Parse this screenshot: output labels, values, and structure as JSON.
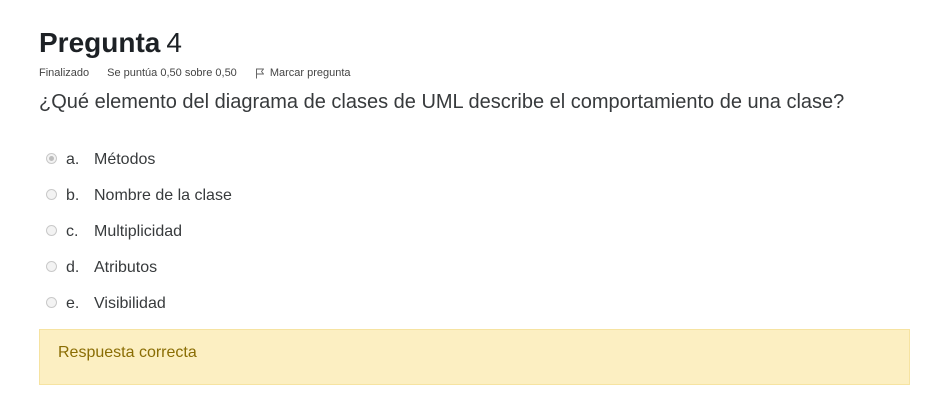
{
  "question": {
    "title_word": "Pregunta",
    "number": "4",
    "state": "Finalizado",
    "grade": "Se puntúa 0,50 sobre 0,50",
    "flag_label": "Marcar pregunta",
    "text": "¿Qué elemento del diagrama de clases de UML describe el comportamiento de una clase?"
  },
  "answers": [
    {
      "letter": "a.",
      "text": "Métodos",
      "selected": true
    },
    {
      "letter": "b.",
      "text": "Nombre de la clase",
      "selected": false
    },
    {
      "letter": "c.",
      "text": "Multiplicidad",
      "selected": false
    },
    {
      "letter": "d.",
      "text": "Atributos",
      "selected": false
    },
    {
      "letter": "e.",
      "text": "Visibilidad",
      "selected": false
    }
  ],
  "feedback": {
    "text": "Respuesta correcta"
  },
  "colors": {
    "feedback_background": "#fcefc2",
    "feedback_text": "#8a6d04"
  },
  "icons": {
    "flag": "flag-icon"
  }
}
